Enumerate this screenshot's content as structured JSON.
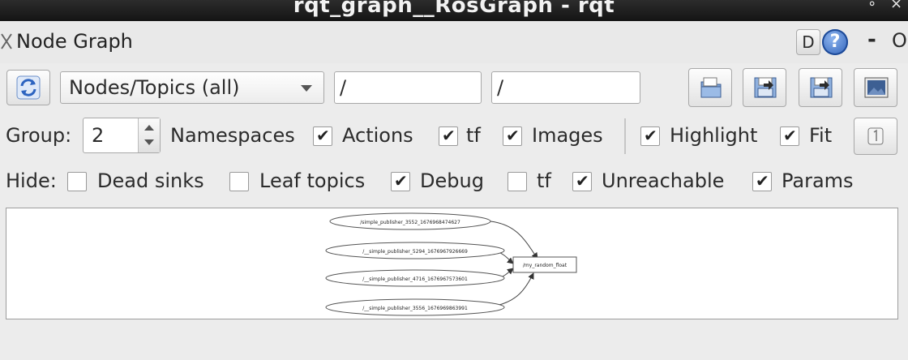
{
  "window": {
    "title": "rqt_graph__RosGraph - rqt",
    "controls": [
      "∘",
      "×"
    ]
  },
  "plugin": {
    "title": "Node Graph",
    "d_label": "D",
    "help_label": "?",
    "minimize_label": "-",
    "close_label": "O"
  },
  "toolbar": {
    "mode_value": "Nodes/Topics (all)",
    "filter_1": "/",
    "filter_2": "/",
    "icons": [
      "refresh-icon",
      "load-dot-icon",
      "save-dot-icon",
      "save-svg-icon",
      "save-image-icon"
    ]
  },
  "options": {
    "group_label": "Group:",
    "group_value": "2",
    "namespaces_label": "Namespaces",
    "namespaces": true,
    "actions_label": "Actions",
    "actions": true,
    "tf_label": "tf",
    "tf": true,
    "images_label": "Images",
    "images": true,
    "highlight_label": "Highlight",
    "highlight": true,
    "fit_label": "Fit",
    "fit": true
  },
  "hide": {
    "label": "Hide:",
    "dead_sinks_label": "Dead sinks",
    "dead_sinks": false,
    "leaf_topics_label": "Leaf topics",
    "leaf_topics": false,
    "debug_label": "Debug",
    "debug": true,
    "tf_label": "tf",
    "tf": false,
    "unreachable_label": "Unreachable",
    "unreachable": true,
    "params_label": "Params",
    "params": true
  },
  "graph": {
    "nodes": [
      "/simple_publisher_3552_1676968474627",
      "/__simple_publisher_5294_1676967926669",
      "/__simple_publisher_4716_1676967573601",
      "/__simple_publisher_3556_1676969863991"
    ],
    "topic": "/my_random_float"
  }
}
